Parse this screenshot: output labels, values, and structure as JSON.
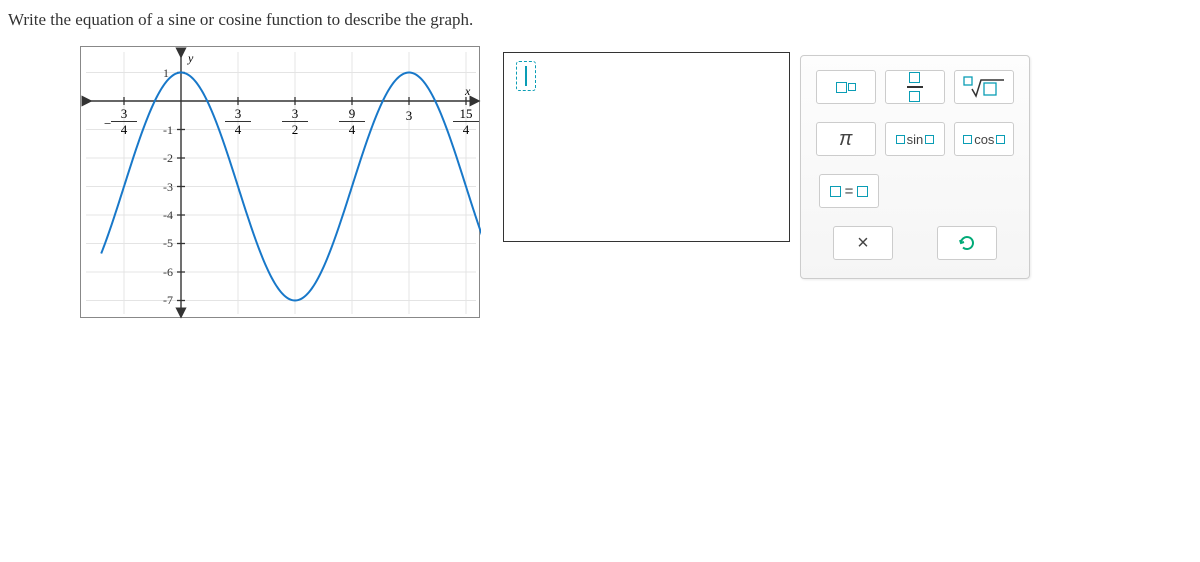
{
  "question": "Write the equation of a sine or cosine function to describe the graph.",
  "chart_data": {
    "type": "line",
    "title": "",
    "xlabel": "x",
    "ylabel": "y",
    "xlim": [
      -1.05,
      4.05
    ],
    "ylim": [
      -8,
      1.5
    ],
    "x_tick_labels": [
      "-3/4",
      "3/4",
      "3/2",
      "9/4",
      "3",
      "15/4"
    ],
    "x_tick_values": [
      -0.75,
      0.75,
      1.5,
      2.25,
      3,
      3.75
    ],
    "y_tick_values": [
      1,
      -1,
      -2,
      -3,
      -4,
      -5,
      -6,
      -7
    ],
    "amplitude": 4,
    "midline": -3,
    "period": 3,
    "function": "y = 4*cos(2*pi/3 * x) - 3",
    "phase_shift": 0
  },
  "y_ticks": {
    "t1": "1",
    "tm1": "-1",
    "tm2": "-2",
    "tm3": "-3",
    "tm4": "-4",
    "tm5": "-5",
    "tm6": "-6",
    "tm7": "-7"
  },
  "x_ticks": [
    {
      "num": "3",
      "den": "4",
      "neg": true
    },
    {
      "num": "3",
      "den": "4",
      "neg": false
    },
    {
      "num": "3",
      "den": "2",
      "neg": false
    },
    {
      "num": "9",
      "den": "4",
      "neg": false
    },
    {
      "num": "3",
      "den": "",
      "neg": false
    },
    {
      "num": "15",
      "den": "4",
      "neg": false
    }
  ],
  "axis_labels": {
    "x": "x",
    "y": "y"
  },
  "tools": {
    "exp_label": "exponent",
    "frac_label": "fraction",
    "root_label": "root",
    "pi": "π",
    "sin": "sin",
    "cos": "cos",
    "eq": "="
  },
  "actions": {
    "clear": "×",
    "undo": "↺"
  }
}
